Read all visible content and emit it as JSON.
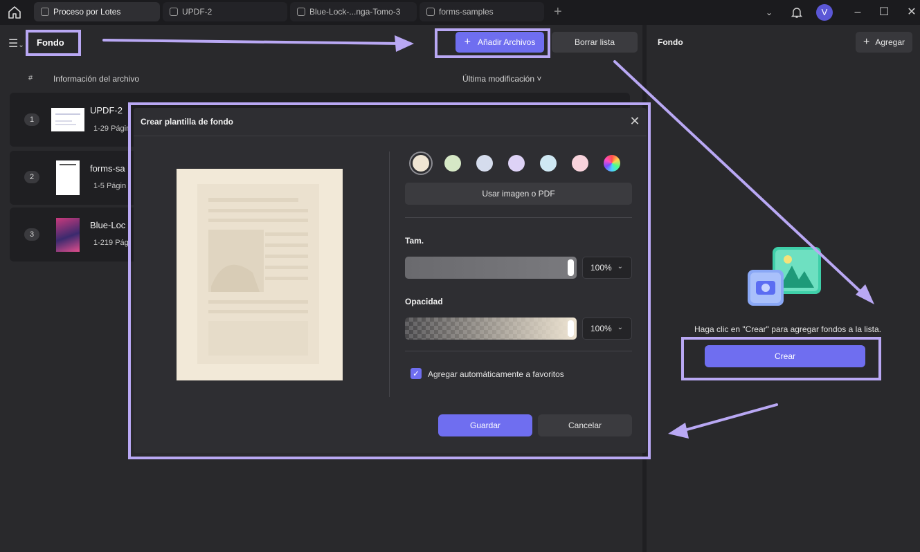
{
  "tabs": [
    {
      "label": "Proceso por Lotes",
      "active": true
    },
    {
      "label": "UPDF-2",
      "active": false
    },
    {
      "label": "Blue-Lock-...nga-Tomo-3",
      "active": false
    },
    {
      "label": "forms-samples",
      "active": false
    }
  ],
  "user_initial": "V",
  "left_panel": {
    "title": "Fondo",
    "add_files_label": "Añadir Archivos",
    "clear_list_label": "Borrar lista",
    "columns": {
      "num": "#",
      "info": "Información del archivo",
      "modified": "Última modificación ˅"
    },
    "files": [
      {
        "index": "1",
        "name": "UPDF-2",
        "pages": "1-29 Págin"
      },
      {
        "index": "2",
        "name": "forms-sa",
        "pages": "1-5 Págin"
      },
      {
        "index": "3",
        "name": "Blue-Loc",
        "pages": "1-219 Pág"
      }
    ]
  },
  "right_panel": {
    "title": "Fondo",
    "add_label": "Agregar",
    "hint": "Haga clic en \"Crear\" para agregar fondos a la lista.",
    "create_label": "Crear"
  },
  "dialog": {
    "title": "Crear plantilla de fondo",
    "swatches": [
      "#efe5d3",
      "#d6e8c6",
      "#d5dced",
      "#ddd2f6",
      "#cfe8f3",
      "#f8d3dc",
      "rainbow"
    ],
    "selected_swatch": 0,
    "use_image_label": "Usar imagen o PDF",
    "size_label": "Tam.",
    "size_value": "100%",
    "opacity_label": "Opacidad",
    "opacity_value": "100%",
    "auto_fav_label": "Agregar automáticamente a favoritos",
    "auto_fav_checked": true,
    "save_label": "Guardar",
    "cancel_label": "Cancelar"
  },
  "colors": {
    "accent": "#6f6ef0",
    "annotation": "#b9a8f4"
  }
}
